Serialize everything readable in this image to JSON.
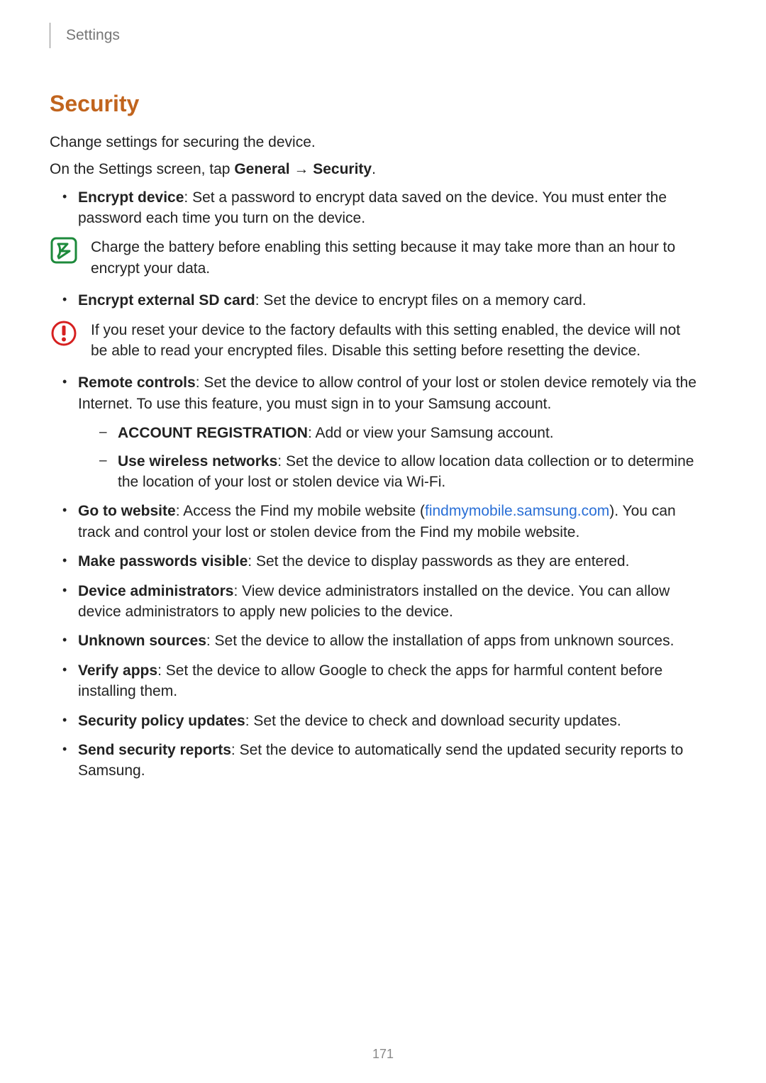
{
  "header": {
    "chapter": "Settings"
  },
  "title": "Security",
  "intro": "Change settings for securing the device.",
  "nav_sentence": {
    "prefix": "On the Settings screen, tap ",
    "step1": "General",
    "arrow": " → ",
    "step2": "Security",
    "suffix": "."
  },
  "bullet1": {
    "term": "Encrypt device",
    "desc": ": Set a password to encrypt data saved on the device. You must enter the password each time you turn on the device."
  },
  "note1": "Charge the battery before enabling this setting because it may take more than an hour to encrypt your data.",
  "bullet2": {
    "term": "Encrypt external SD card",
    "desc": ": Set the device to encrypt files on a memory card."
  },
  "note2": "If you reset your device to the factory defaults with this setting enabled, the device will not be able to read your encrypted files. Disable this setting before resetting the device.",
  "bullet3": {
    "term": "Remote controls",
    "desc": ": Set the device to allow control of your lost or stolen device remotely via the Internet. To use this feature, you must sign in to your Samsung account."
  },
  "sub1": {
    "term": "ACCOUNT REGISTRATION",
    "desc": ": Add or view your Samsung account."
  },
  "sub2": {
    "term": "Use wireless networks",
    "desc": ": Set the device to allow location data collection or to determine the location of your lost or stolen device via Wi-Fi."
  },
  "bullet4": {
    "term": "Go to website",
    "desc_before": ": Access the Find my mobile website (",
    "link": "findmymobile.samsung.com",
    "desc_after": "). You can track and control your lost or stolen device from the Find my mobile website."
  },
  "bullet5": {
    "term": "Make passwords visible",
    "desc": ": Set the device to display passwords as they are entered."
  },
  "bullet6": {
    "term": "Device administrators",
    "desc": ": View device administrators installed on the device. You can allow device administrators to apply new policies to the device."
  },
  "bullet7": {
    "term": "Unknown sources",
    "desc": ": Set the device to allow the installation of apps from unknown sources."
  },
  "bullet8": {
    "term": "Verify apps",
    "desc": ": Set the device to allow Google to check the apps for harmful content before installing them."
  },
  "bullet9": {
    "term": "Security policy updates",
    "desc": ": Set the device to check and download security updates."
  },
  "bullet10": {
    "term": "Send security reports",
    "desc": ": Set the device to automatically send the updated security reports to Samsung."
  },
  "page_number": "171"
}
